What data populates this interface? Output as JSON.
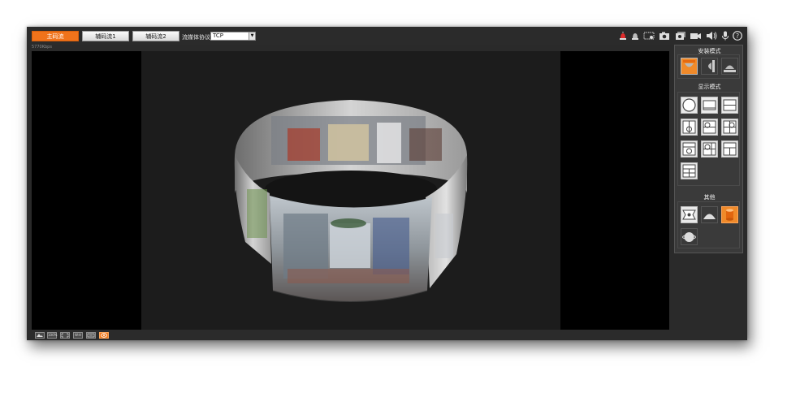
{
  "toolbar": {
    "tabs": [
      {
        "label": "主码流",
        "active": true
      },
      {
        "label": "辅码流1",
        "active": false
      },
      {
        "label": "辅码流2",
        "active": false
      }
    ],
    "protocol_label": "流媒体协议",
    "protocol_value": "TCP",
    "right_icons": [
      "alarm-icon",
      "alarm-out-icon",
      "region-icon",
      "snapshot-icon",
      "triple-snapshot-icon",
      "record-icon",
      "audio-icon",
      "talk-icon",
      "help-icon"
    ]
  },
  "video": {
    "bitrate": "5770Kbps"
  },
  "bottom_bar": {
    "buttons": [
      "image-adjust-icon",
      "original-size-icon",
      "fullscreen-icon",
      "aspect-ratio-icon",
      "smooth-icon",
      "fisheye-icon"
    ],
    "active_button": "fisheye-icon",
    "labels": {
      "original_size": "100%",
      "aspect_ratio": "W:H"
    }
  },
  "side_panel": {
    "install_mode": {
      "title": "安装模式",
      "options": [
        "ceiling-mount-icon",
        "wall-mount-icon",
        "ground-mount-icon"
      ],
      "selected": "ceiling-mount-icon"
    },
    "display_mode": {
      "title": "显示模式",
      "options": [
        "fisheye-original-icon",
        "panorama-180-icon",
        "panorama-360-icon",
        "fisheye-plus-1-icon",
        "fisheye-plus-2-icon",
        "fisheye-plus-3-icon",
        "fisheye-plus-4-icon",
        "fisheye-plus-6-icon",
        "panorama-plus-4-icon",
        "panorama-plus-8-icon"
      ]
    },
    "other": {
      "title": "其他",
      "options": [
        "flat-view-icon",
        "hemisphere-view-icon",
        "cylinder-view-icon",
        "sphere-view-icon"
      ],
      "selected": "cylinder-view-icon"
    }
  },
  "colors": {
    "accent": "#f0731b",
    "background": "#2a2a2a",
    "panel": "#3a3a3a"
  }
}
